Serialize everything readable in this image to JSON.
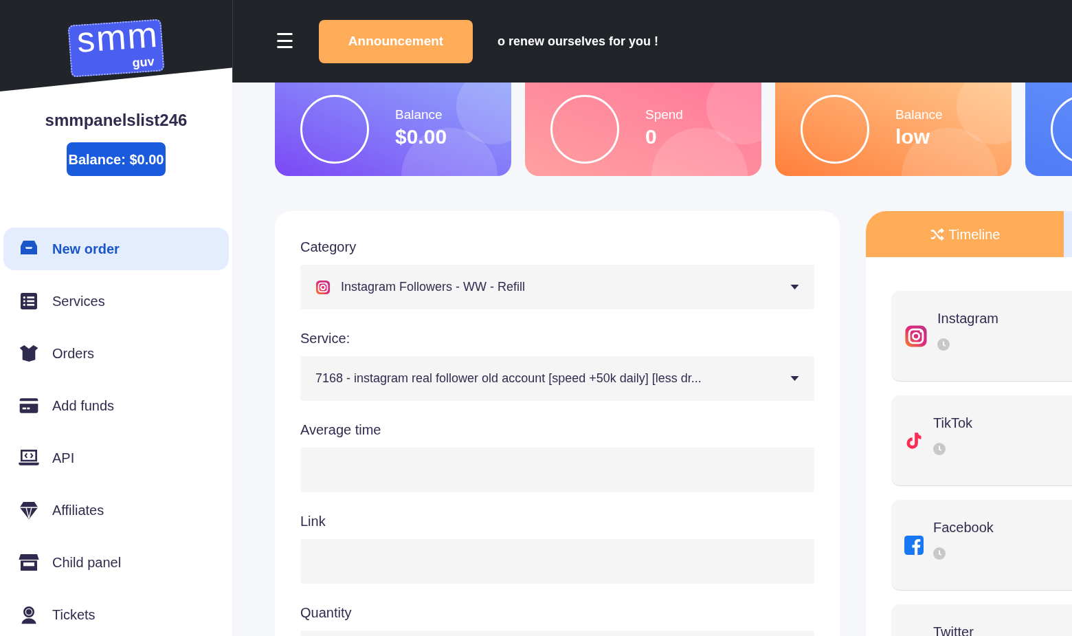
{
  "sidebar": {
    "logo": {
      "main": "smm",
      "sub": "guv"
    },
    "username": "smmpanelslist246",
    "balance_button": "Balance: $0.00",
    "items": [
      {
        "label": "New order",
        "kind": "inbox",
        "selected": true
      },
      {
        "label": "Services",
        "kind": "list",
        "selected": false
      },
      {
        "label": "Orders",
        "kind": "box",
        "selected": false
      },
      {
        "label": "Add funds",
        "kind": "card",
        "selected": false
      },
      {
        "label": "API",
        "kind": "code",
        "selected": false
      },
      {
        "label": "Affiliates",
        "kind": "gem",
        "selected": false
      },
      {
        "label": "Child panel",
        "kind": "store",
        "selected": false
      },
      {
        "label": "Tickets",
        "kind": "headset",
        "selected": false
      }
    ]
  },
  "topbar": {
    "menu_icon": "☰",
    "announcement_button": "Announcement",
    "ticker": "o renew ourselves for you !"
  },
  "stats": [
    {
      "kind": "purple",
      "label": "Balance",
      "value": "$0.00"
    },
    {
      "kind": "pink",
      "label": "Spend",
      "value": "0"
    },
    {
      "kind": "orange",
      "label": "Balance",
      "value": "low"
    },
    {
      "kind": "blue"
    }
  ],
  "order_form": {
    "fields": [
      {
        "label": "Category",
        "kind": "iconselect",
        "value": "Instagram Followers - WW - Refill"
      },
      {
        "label": "Service:",
        "kind": "select",
        "value": "7168 - instagram real follower old account [speed +50k daily] [less dr..."
      },
      {
        "label": "Average time",
        "kind": "input"
      },
      {
        "label": "Link",
        "kind": "input"
      },
      {
        "label": "Quantity",
        "kind": "input"
      }
    ]
  },
  "timeline": {
    "tab": "Timeline",
    "items": [
      {
        "name": "Instagram",
        "kind": "instagram"
      },
      {
        "name": "TikTok",
        "kind": "tiktok"
      },
      {
        "name": "Facebook",
        "kind": "facebook"
      },
      {
        "name": "Twitter",
        "kind": "twitter"
      }
    ]
  }
}
